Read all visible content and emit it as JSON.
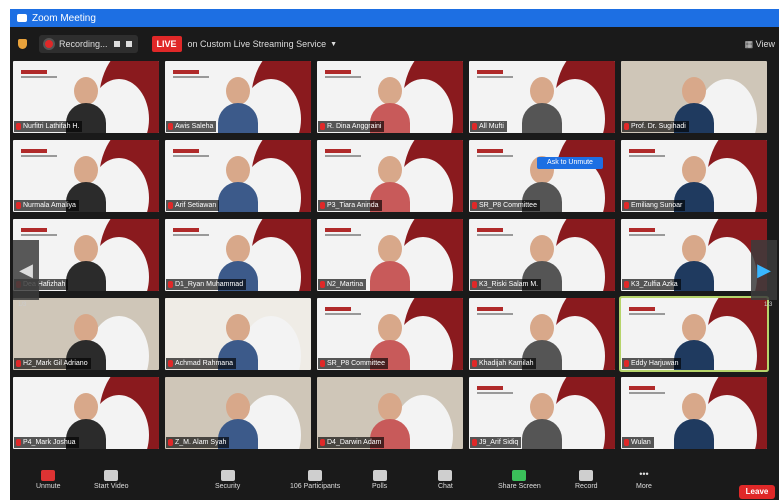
{
  "window": {
    "title": "Zoom Meeting"
  },
  "topbar": {
    "recording_label": "Recording...",
    "live_badge": "LIVE",
    "live_text": "on Custom Live Streaming Service",
    "view_label": "View"
  },
  "tooltip": "Ask to Unmute",
  "nav": {
    "left_page": "1/3",
    "right_page": "1/3"
  },
  "participants": [
    {
      "name": "Nurfitri Lathifah H."
    },
    {
      "name": "Awis Saleha"
    },
    {
      "name": "R. Dina Anggraini"
    },
    {
      "name": "All Mufti"
    },
    {
      "name": "Prof. Dr. Sugihadi"
    },
    {
      "name": "Nurmala Amaliya"
    },
    {
      "name": "Arif Setiawan"
    },
    {
      "name": "P3_Tiara Aninda"
    },
    {
      "name": "SR_P8 Committee"
    },
    {
      "name": "Emiliang Sunoar"
    },
    {
      "name": "Dea Hafizhah"
    },
    {
      "name": "D1_Ryan Muhammad"
    },
    {
      "name": "N2_Martina"
    },
    {
      "name": "K3_Riski Salam M."
    },
    {
      "name": "K3_Zulfia Azka"
    },
    {
      "name": "H2_Mark Gil Adriano"
    },
    {
      "name": "Achmad Rahmana"
    },
    {
      "name": "SR_P8 Committee"
    },
    {
      "name": "Khadijah Kamilah"
    },
    {
      "name": "Eddy Harjuwan"
    },
    {
      "name": "P4_Mark Joshua"
    },
    {
      "name": "Z_M. Alam Syah"
    },
    {
      "name": "D4_Darwin Adam"
    },
    {
      "name": "J9_Arif Sidiq"
    },
    {
      "name": "Wulan"
    }
  ],
  "toolbar": {
    "unmute": "Unmute",
    "start_video": "Start Video",
    "security": "Security",
    "participants": "Participants",
    "participants_count": "106",
    "polls": "Polls",
    "chat": "Chat",
    "share_screen": "Share Screen",
    "record": "Record",
    "more": "More",
    "leave": "Leave"
  }
}
